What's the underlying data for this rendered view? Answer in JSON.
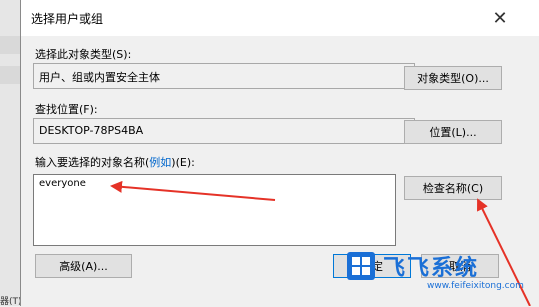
{
  "background": {
    "left_text": "器(T)"
  },
  "dialog": {
    "title": "选择用户或组",
    "object_type": {
      "label": "选择此对象类型(S):",
      "value": "用户、组或内置安全主体",
      "button": "对象类型(O)..."
    },
    "location": {
      "label": "查找位置(F):",
      "value": "DESKTOP-78PS4BA",
      "button": "位置(L)..."
    },
    "names": {
      "label_prefix": "输入要选择的对象名称(",
      "label_link": "例如",
      "label_suffix": ")(E):",
      "value": "everyone",
      "check_button": "检查名称(C)"
    },
    "advanced_button": "高级(A)...",
    "ok_button": "确定",
    "cancel_button": "取消"
  },
  "watermark": {
    "brand": "飞飞系统",
    "url": "www.feifeixitong.com"
  },
  "colors": {
    "annotation_arrow": "#e53227",
    "link": "#0066cc",
    "focus_border": "#0078d7",
    "watermark": "#1a6fd6"
  }
}
